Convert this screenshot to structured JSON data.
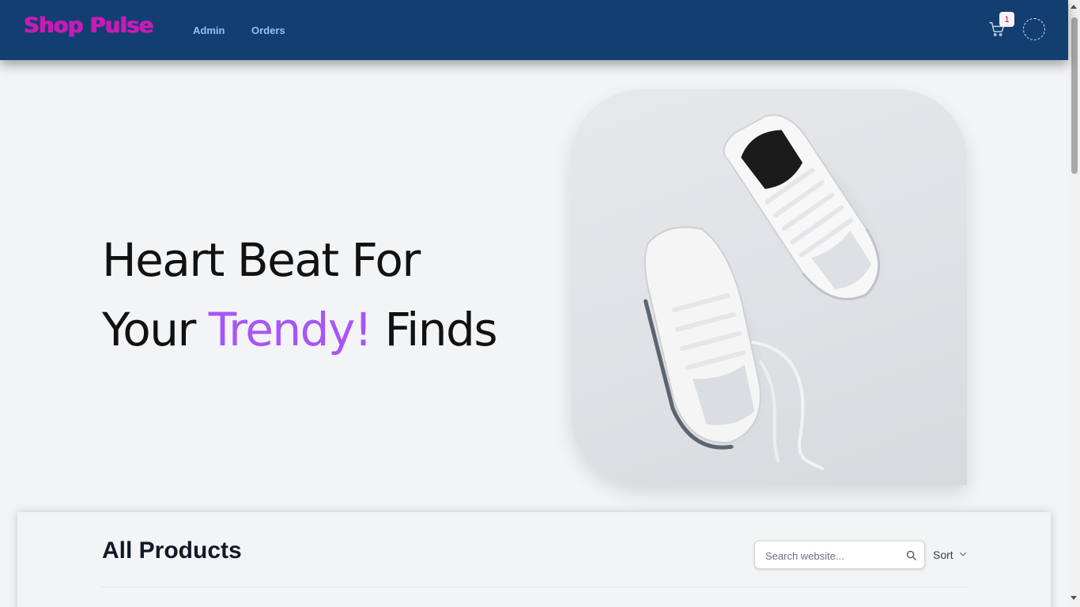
{
  "header": {
    "logo": "Shop Pulse",
    "nav": [
      {
        "label": "Admin"
      },
      {
        "label": "Orders"
      }
    ],
    "cart_count": "1",
    "icons": {
      "cart": "shopping-cart-icon",
      "avatar": "user-avatar"
    }
  },
  "hero": {
    "line1": "Heart Beat For",
    "line2_prefix": "Your",
    "line2_accent": "Trendy!",
    "line2_suffix": "Finds",
    "accent_color": "#a855f7",
    "image": "white-sneakers-photo"
  },
  "products": {
    "title": "All Products",
    "search_placeholder": "Search website...",
    "sort_label": "Sort"
  },
  "colors": {
    "header_bg": "#133e72",
    "logo": "#c81bb3",
    "nav_link": "#8ec3f5",
    "page_bg": "#f3f4f6"
  }
}
